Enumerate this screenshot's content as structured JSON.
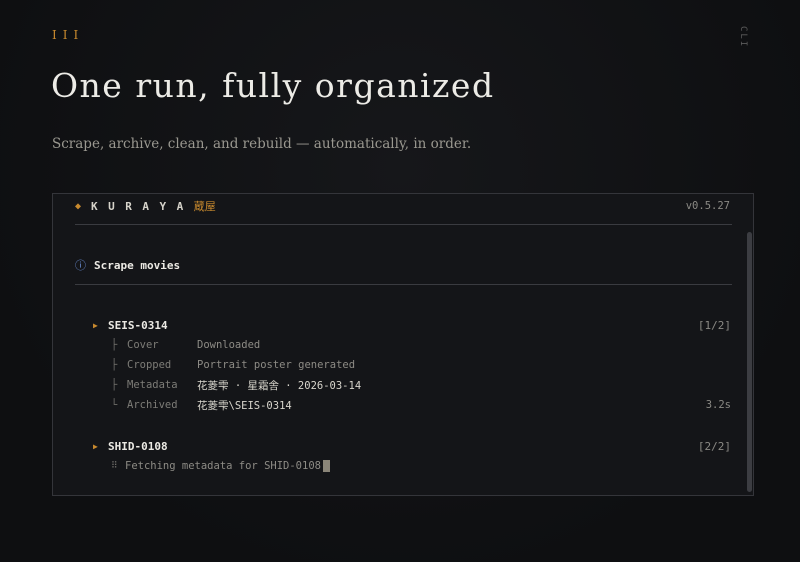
{
  "page": {
    "roman": "III",
    "side_tag": "CLI",
    "title": "One run, fully organized",
    "subtitle": "Scrape, archive, clean, and rebuild — automatically, in order."
  },
  "terminal": {
    "brand": "KURAYA",
    "brand_kanji": "蔵屋",
    "version": "v0.5.27",
    "section_label": "Scrape movies",
    "jobs": [
      {
        "id": "SEIS-0314",
        "count": "[1/2]",
        "steps": [
          {
            "branch": "├",
            "label": "Cover",
            "value": "Downloaded"
          },
          {
            "branch": "├",
            "label": "Cropped",
            "value": "Portrait poster generated"
          },
          {
            "branch": "├",
            "label": "Metadata",
            "value": "花菱雫 · 星霜舎 · 2026-03-14"
          },
          {
            "branch": "└",
            "label": "Archived",
            "value": "花菱雫\\SEIS-0314",
            "time": "3.2s"
          }
        ]
      },
      {
        "id": "SHID-0108",
        "count": "[2/2]",
        "status": "Fetching metadata for SHID-0108"
      }
    ]
  },
  "icons": {
    "brand": "diamond-icon",
    "section": "info-icon",
    "job": "triangle-right-icon",
    "progress": "spinner-icon"
  },
  "colors": {
    "accent": "#c98a2e",
    "info": "#6b8fd6",
    "background": "#111214"
  }
}
